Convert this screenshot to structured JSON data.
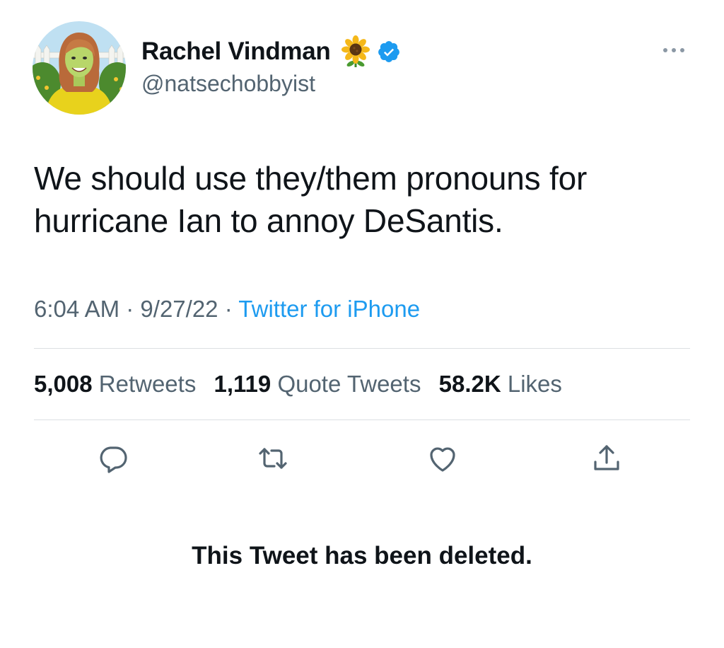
{
  "tweet": {
    "author": {
      "display_name": "Rachel Vindman",
      "handle": "@natsechobbyist",
      "name_emoji": "sunflower-icon",
      "verified": true,
      "verified_color": "#1d9bf0",
      "avatar": "avatar-illustration"
    },
    "text_line1": "We should use they/them pronouns for",
    "text_line2": "hurricane Ian to annoy DeSantis.",
    "time": "6:04 AM",
    "separator": "·",
    "date": "9/27/22",
    "source": "Twitter for iPhone",
    "stats": {
      "retweets_count": "5,008",
      "retweets_label": "Retweets",
      "quotes_count": "1,119",
      "quotes_label": "Quote Tweets",
      "likes_count": "58.2K",
      "likes_label": "Likes"
    },
    "actions": [
      "reply-icon",
      "retweet-icon",
      "like-icon",
      "share-icon"
    ]
  },
  "notice": "This Tweet has been deleted.",
  "colors": {
    "link": "#1d9bf0",
    "secondary_text": "#536471",
    "primary_text": "#0f1419",
    "divider": "#dcdfe2"
  }
}
